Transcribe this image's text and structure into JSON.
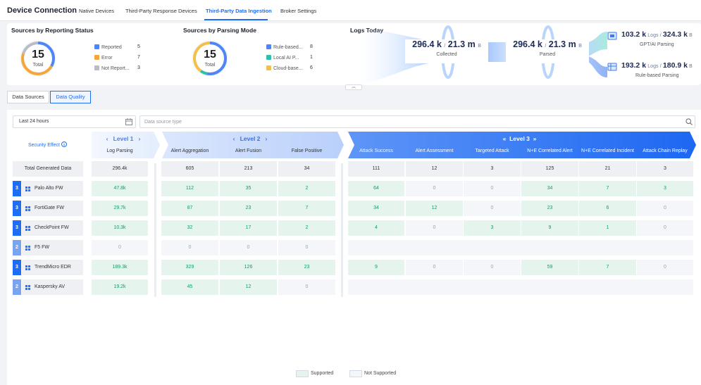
{
  "header": {
    "title": "Device Connection",
    "tabs": [
      "Native Devices",
      "Third-Party Response Devices",
      "Third-Party Data Ingestion",
      "Broker Settings"
    ],
    "active_tab": 2
  },
  "reporting": {
    "title": "Sources by Reporting Status",
    "total": "15",
    "total_label": "Total",
    "items": [
      {
        "label": "Reported",
        "value": "5",
        "color": "#4f86f7"
      },
      {
        "label": "Error",
        "value": "7",
        "color": "#f5a53a"
      },
      {
        "label": "Not Report...",
        "value": "3",
        "color": "#b9bdc6"
      }
    ]
  },
  "parsing": {
    "title": "Sources by Parsing Mode",
    "total": "15",
    "total_label": "Total",
    "items": [
      {
        "label": "Rule-based...",
        "value": "8",
        "color": "#4f86f7"
      },
      {
        "label": "Local AI P...",
        "value": "1",
        "color": "#2fc1a8"
      },
      {
        "label": "Cloud-base...",
        "value": "6",
        "color": "#f5c04a"
      }
    ]
  },
  "logs": {
    "title": "Logs Today",
    "collected": {
      "count": "296.4 k",
      "size": "21.3 m",
      "unit": "B",
      "label": "Collected"
    },
    "parsed": {
      "count": "296.4 k",
      "size": "21.3 m",
      "unit": "B",
      "label": "Parsed"
    },
    "outputs": [
      {
        "count": "103.2 k",
        "logs_label": "Logs",
        "size": "324.3 k",
        "unit": "B",
        "label": "GPT/AI Parsing",
        "icon": "ai-chip-icon"
      },
      {
        "count": "193.2 k",
        "logs_label": "Logs",
        "size": "180.9 k",
        "unit": "B",
        "label": "Rule-based Parsing",
        "icon": "rule-table-icon"
      }
    ]
  },
  "subtabs": [
    "Data Sources",
    "Data Quality"
  ],
  "active_subtab": 1,
  "filters": {
    "date_range": "Last 24 hours",
    "search_placeholder": "Data source type"
  },
  "matrix": {
    "security_effect_label": "Security Effect",
    "levels": [
      {
        "name": "Level 1",
        "columns": [
          "Log Parsing"
        ]
      },
      {
        "name": "Level 2",
        "columns": [
          "Alert Aggregation",
          "Alert Fusion",
          "False Positive"
        ]
      },
      {
        "name": "Level 3",
        "columns": [
          "Attack Success",
          "Alert Assessment",
          "Targeted Attack",
          "N+E Correlated Alert",
          "N+E Correlated Incident",
          "Attack Chain Replay"
        ]
      }
    ],
    "total_row": {
      "label": "Total Generated Data",
      "values": [
        "296.4k",
        "605",
        "213",
        "34",
        "111",
        "12",
        "3",
        "125",
        "21",
        "3"
      ]
    },
    "rows": [
      {
        "level": "3",
        "name": "Palo Alto FW",
        "values": [
          "47.8k",
          "112",
          "35",
          "2",
          "64",
          "0",
          "0",
          "34",
          "7",
          "3"
        ],
        "supported": [
          1,
          1,
          1,
          1,
          1,
          1,
          1,
          1,
          1,
          1
        ]
      },
      {
        "level": "3",
        "name": "FortiGate FW",
        "values": [
          "29.7k",
          "87",
          "23",
          "7",
          "34",
          "12",
          "0",
          "23",
          "6",
          "0"
        ],
        "supported": [
          1,
          1,
          1,
          1,
          1,
          1,
          1,
          1,
          1,
          1
        ]
      },
      {
        "level": "3",
        "name": "CheckPoint FW",
        "values": [
          "10.3k",
          "32",
          "17",
          "2",
          "4",
          "0",
          "3",
          "9",
          "1",
          "0"
        ],
        "supported": [
          1,
          1,
          1,
          1,
          1,
          1,
          1,
          1,
          1,
          1
        ]
      },
      {
        "level": "2",
        "name": "F5 FW",
        "values": [
          "0",
          "0",
          "0",
          "0",
          "",
          "",
          "",
          "",
          "",
          ""
        ],
        "supported": [
          1,
          1,
          1,
          1,
          0,
          0,
          0,
          0,
          0,
          0
        ]
      },
      {
        "level": "3",
        "name": "TrendMicro EDR",
        "values": [
          "189.3k",
          "329",
          "126",
          "23",
          "9",
          "0",
          "0",
          "59",
          "7",
          "0"
        ],
        "supported": [
          1,
          1,
          1,
          1,
          1,
          1,
          1,
          1,
          1,
          1
        ]
      },
      {
        "level": "2",
        "name": "Kaspersky AV",
        "values": [
          "19.2k",
          "45",
          "12",
          "0",
          "",
          "",
          "",
          "",
          "",
          ""
        ],
        "supported": [
          1,
          1,
          1,
          1,
          0,
          0,
          0,
          0,
          0,
          0
        ]
      }
    ]
  },
  "footer_legend": [
    {
      "label": "Supported",
      "color": "#e6f4ee"
    },
    {
      "label": "Not Supported",
      "color": "#f4f6fa"
    }
  ],
  "colors": {
    "accent": "#1e6ef5",
    "supported_text": "#1a9863",
    "level3": "#1e6ef5",
    "level2": "#7aa4f0"
  }
}
